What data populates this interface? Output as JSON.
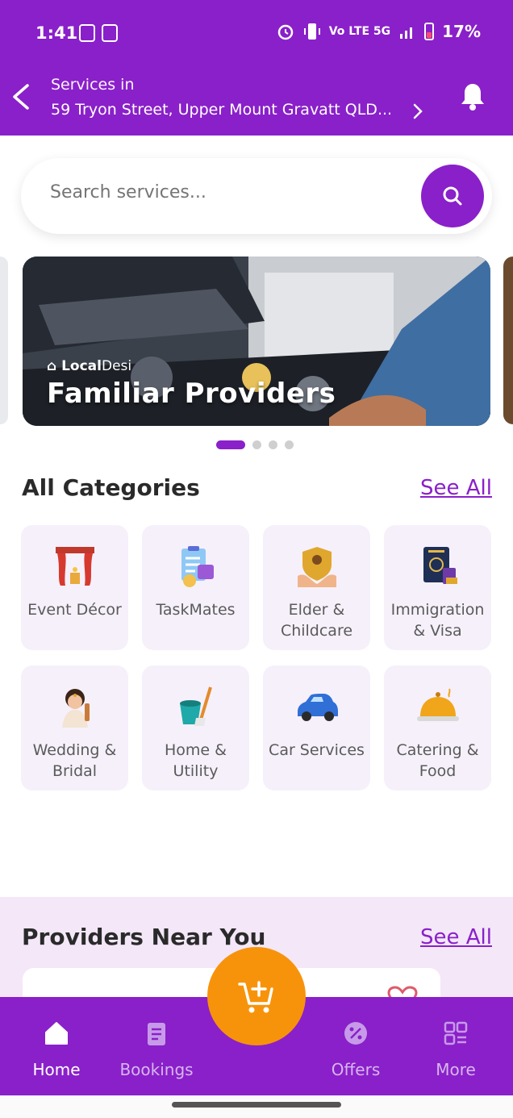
{
  "status_bar": {
    "time": "1:41",
    "network": "Vo LTE 5G",
    "battery": "17%"
  },
  "header": {
    "label": "Services in",
    "address": "59 Tryon Street, Upper Mount Gravatt QLD..."
  },
  "search": {
    "placeholder": "Search services..."
  },
  "banner": {
    "brand_bold": "Local",
    "brand_regular": "Desi",
    "title": "Familiar Providers",
    "slides": 4,
    "active_slide": 1
  },
  "categories": {
    "title": "All Categories",
    "see_all": "See All",
    "items": [
      {
        "label": "Event Décor",
        "icon": "curtain-stage-icon"
      },
      {
        "label": "TaskMates",
        "icon": "task-clipboard-icon"
      },
      {
        "label": "Elder & Childcare",
        "icon": "care-hands-icon"
      },
      {
        "label": "Immigration & Visa",
        "icon": "passport-icon"
      },
      {
        "label": "Wedding & Bridal",
        "icon": "bride-icon"
      },
      {
        "label": "Home & Utility",
        "icon": "bucket-mop-icon"
      },
      {
        "label": "Car Services",
        "icon": "car-icon"
      },
      {
        "label": "Catering & Food",
        "icon": "food-cloche-icon"
      }
    ]
  },
  "providers": {
    "title": "Providers Near You",
    "see_all": "See All"
  },
  "bottom_nav": {
    "items": [
      {
        "label": "Home",
        "icon": "home-icon",
        "active": true
      },
      {
        "label": "Bookings",
        "icon": "clipboard-icon",
        "active": false
      },
      {
        "label": "Offers",
        "icon": "discount-badge-icon",
        "active": false
      },
      {
        "label": "More",
        "icon": "grid-icon",
        "active": false
      }
    ],
    "fab_icon": "cart-add-icon"
  },
  "colors": {
    "primary": "#8a20c9",
    "accent": "#f7930b",
    "card_bg": "#f6f0fb",
    "section_bg": "#f3e7f8"
  }
}
